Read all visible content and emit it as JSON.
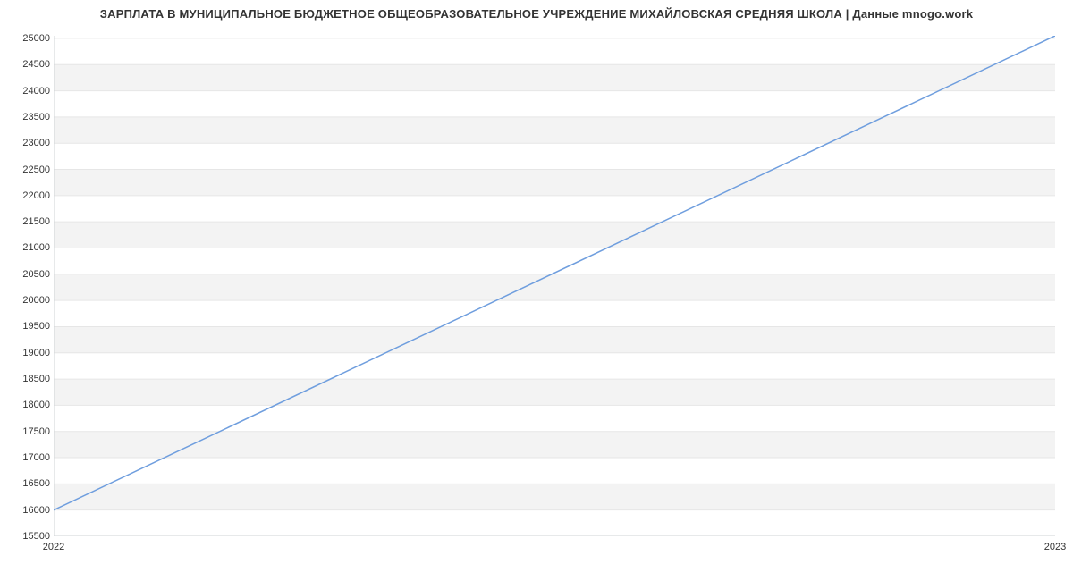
{
  "chart_data": {
    "type": "line",
    "title": "ЗАРПЛАТА В МУНИЦИПАЛЬНОЕ БЮДЖЕТНОЕ ОБЩЕОБРАЗОВАТЕЛЬНОЕ УЧРЕЖДЕНИЕ МИХАЙЛОВСКАЯ СРЕДНЯЯ ШКОЛА | Данные mnogo.work",
    "xlabel": "",
    "ylabel": "",
    "x_categories": [
      "2022",
      "2023"
    ],
    "x_positions": [
      0,
      1
    ],
    "xlim": [
      0,
      1
    ],
    "y_ticks": [
      15500,
      16000,
      16500,
      17000,
      17500,
      18000,
      18500,
      19000,
      19500,
      20000,
      20500,
      21000,
      21500,
      22000,
      22500,
      23000,
      23500,
      24000,
      24500,
      25000
    ],
    "ylim": [
      15500,
      25050
    ],
    "series": [
      {
        "name": "salary",
        "x": [
          0,
          1
        ],
        "y": [
          16000,
          25050
        ],
        "color": "#6f9ede"
      }
    ],
    "band_color": "#f3f3f3",
    "grid_color": "#e6e6e6",
    "axis_color": "#cfd3d6"
  }
}
